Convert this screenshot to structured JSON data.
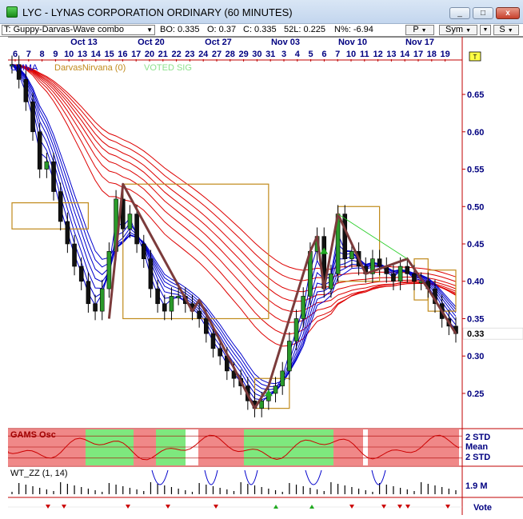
{
  "window": {
    "title": "LYC - LYNAS CORPORATION  ORDINARY (60 MINUTES)",
    "min_label": "_",
    "max_label": "□",
    "close_label": "x"
  },
  "toolbar": {
    "study_value": "T: Guppy-Darvas-Wave combo",
    "bo": "BO: 0.335",
    "open": "O: 0.37",
    "close": "C: 0.335",
    "low52": "52L: 0.225",
    "pct": "N%: -6.94",
    "p_label": "P",
    "sym_label": "Sym",
    "s_label": "S"
  },
  "colors": {
    "guppy_short": "#0000cc",
    "guppy_long": "#dd0000",
    "darvas_box": "#c08a1a",
    "wave": "#7b3b3b",
    "osc_green": "#7ee87e",
    "osc_red": "#f08888",
    "axis": "#c00000",
    "date_label": "#000080"
  },
  "chart_data": {
    "type": "candlestick",
    "title": "",
    "legend": [
      {
        "name": "GMMA",
        "color": "#0000cc"
      },
      {
        "name": "DarvasNirvana (0)",
        "color": "#c08a1a"
      },
      {
        "name": "VOTED SIG",
        "color": "#8be08b"
      }
    ],
    "month_labels": [
      "Oct 13",
      "Oct 20",
      "Oct 27",
      "Nov 03",
      "Nov 10",
      "Nov 17"
    ],
    "day_labels": [
      "6",
      "7",
      "8",
      "9",
      "10",
      "13",
      "14",
      "15",
      "16",
      "17",
      "20",
      "21",
      "22",
      "23",
      "24",
      "27",
      "28",
      "29",
      "30",
      "31",
      "3",
      "4",
      "5",
      "6",
      "7",
      "10",
      "11",
      "12",
      "13",
      "14",
      "17",
      "18",
      "19"
    ],
    "y_ticks": [
      0.25,
      0.3,
      0.35,
      0.4,
      0.45,
      0.5,
      0.55,
      0.6,
      0.65
    ],
    "y_tick_labels": [
      "0.25",
      "0.30",
      "0.35",
      "0.40",
      "0.45",
      "0.50",
      "0.55",
      "0.60",
      "0.65"
    ],
    "ylim": [
      0.205,
      0.695
    ],
    "last_price": 0.33,
    "last_price_label": "0.33",
    "closes": [
      0.69,
      0.67,
      0.64,
      0.6,
      0.55,
      0.56,
      0.52,
      0.48,
      0.45,
      0.42,
      0.4,
      0.37,
      0.36,
      0.39,
      0.44,
      0.51,
      0.47,
      0.49,
      0.45,
      0.43,
      0.39,
      0.37,
      0.36,
      0.38,
      0.38,
      0.37,
      0.36,
      0.35,
      0.33,
      0.31,
      0.3,
      0.28,
      0.27,
      0.26,
      0.24,
      0.23,
      0.24,
      0.25,
      0.26,
      0.28,
      0.32,
      0.35,
      0.38,
      0.44,
      0.46,
      0.39,
      0.41,
      0.49,
      0.43,
      0.44,
      0.42,
      0.41,
      0.43,
      0.42,
      0.41,
      0.4,
      0.42,
      0.41,
      0.4,
      0.4,
      0.39,
      0.37,
      0.35,
      0.34,
      0.33
    ]
  },
  "oscillator": {
    "title": "GAMS Osc",
    "labels": [
      "2 STD",
      "Mean",
      "2 STD"
    ],
    "zones": [
      "red",
      "green",
      "red",
      "green",
      "white",
      "red",
      "green",
      "red",
      "white",
      "red"
    ]
  },
  "wave_panel": {
    "title": "WT_ZZ (1, 14)",
    "volume_label": "1.9 M"
  },
  "vote_panel": {
    "label": "Vote"
  }
}
